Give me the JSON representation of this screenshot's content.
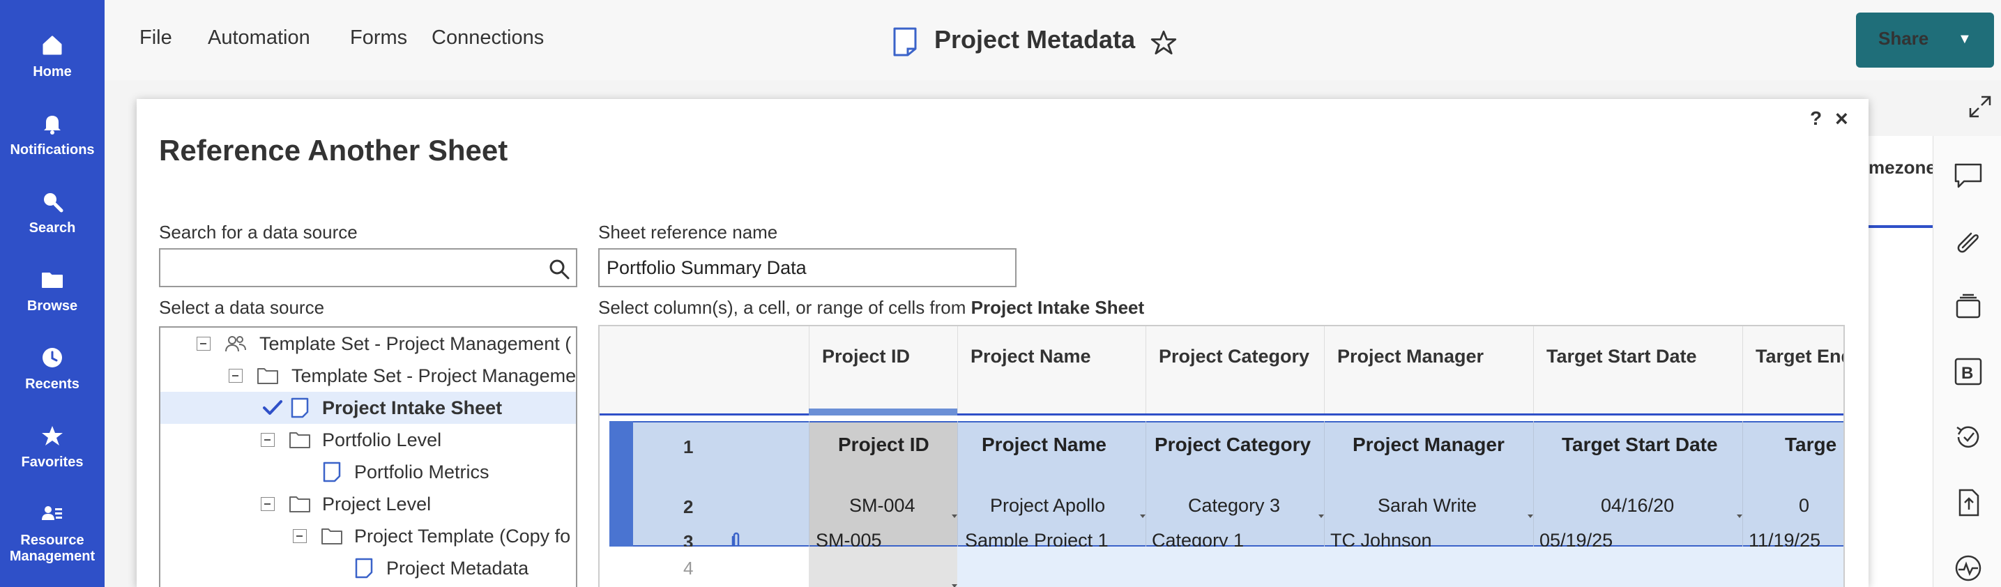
{
  "nav": {
    "items": [
      {
        "label": "Home",
        "icon": "home-icon"
      },
      {
        "label": "Notifications",
        "icon": "bell-icon"
      },
      {
        "label": "Search",
        "icon": "search-icon"
      },
      {
        "label": "Browse",
        "icon": "folder-icon"
      },
      {
        "label": "Recents",
        "icon": "clock-icon"
      },
      {
        "label": "Favorites",
        "icon": "star-icon"
      },
      {
        "label": "Resource",
        "label2": "Management",
        "icon": "people-icon"
      }
    ]
  },
  "menu": {
    "file": "File",
    "automation": "Automation",
    "forms": "Forms",
    "connections": "Connections"
  },
  "header": {
    "title": "Project Metadata",
    "share": "Share"
  },
  "bg_sheet": {
    "column_fragment": "mezone"
  },
  "modal": {
    "title": "Reference Another Sheet",
    "help": "?",
    "close": "×",
    "search_label": "Search for a data source",
    "search_value": "",
    "select_label": "Select a data source",
    "ref_label": "Sheet reference name",
    "ref_value": "Portfolio Summary Data",
    "cols_prefix": "Select column(s), a cell, or range of cells from ",
    "cols_sheet": "Project Intake Sheet",
    "tree": [
      {
        "label": "Template Set - Project Management (",
        "type": "workspace",
        "level": 0,
        "selected": false
      },
      {
        "label": "Template Set - Project Manageme",
        "type": "folder",
        "level": 1,
        "selected": false
      },
      {
        "label": "Project Intake Sheet",
        "type": "sheet",
        "level": 2,
        "selected": true
      },
      {
        "label": "Portfolio Level",
        "type": "folder",
        "level": 2,
        "selected": false
      },
      {
        "label": "Portfolio Metrics",
        "type": "sheet",
        "level": 3,
        "selected": false
      },
      {
        "label": "Project Level",
        "type": "folder",
        "level": 2,
        "selected": false
      },
      {
        "label": "Project Template (Copy fo",
        "type": "folder",
        "level": 3,
        "selected": false
      },
      {
        "label": "Project Metadata",
        "type": "sheet",
        "level": 4,
        "selected": false
      }
    ]
  },
  "grid": {
    "columns": [
      "Project ID",
      "Project Name",
      "Project Category",
      "Project Manager",
      "Target Start Date",
      "Target End"
    ],
    "row_numbers": [
      "1",
      "2",
      "3",
      "4"
    ],
    "rows": [
      [
        "Project ID",
        "Project Name",
        "Project Category",
        "Project Manager",
        "Target Start Date",
        "Targe"
      ],
      [
        "SM-004",
        "Project Apollo",
        "Category 3",
        "Sarah Write",
        "04/16/20",
        "0"
      ],
      [
        "SM-005",
        "Sample Project 1",
        "Category 1",
        "TC Johnson",
        "05/19/25",
        "11/19/25"
      ]
    ]
  },
  "colors": {
    "nav": "#2f50c8",
    "share": "#1f6e79",
    "selection": "#c8d8ef",
    "selection_border": "#3b63c9"
  }
}
